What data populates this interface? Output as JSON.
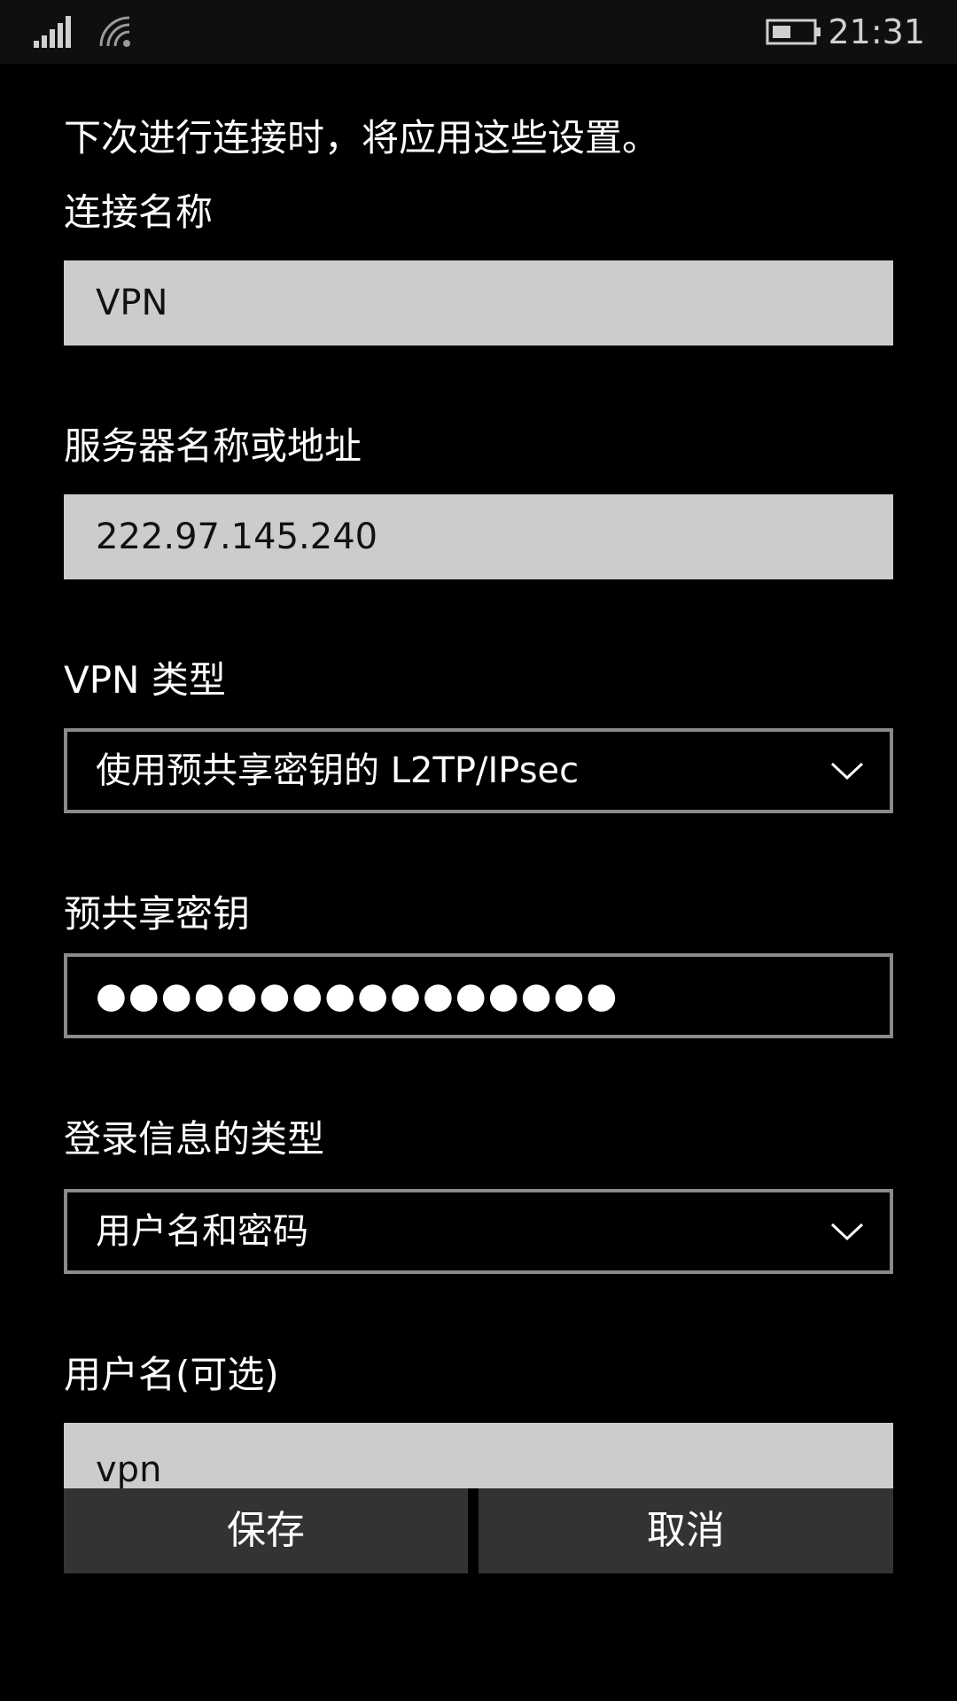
{
  "status_bar": {
    "time": "21:31",
    "icons": [
      "signal-icon",
      "wifi-icon",
      "battery-icon"
    ]
  },
  "form": {
    "intro": "下次进行连接时，将应用这些设置。",
    "connection_name": {
      "label": "连接名称",
      "value": "VPN"
    },
    "server": {
      "label": "服务器名称或地址",
      "value": "222.97.145.240"
    },
    "vpn_type": {
      "label": "VPN 类型",
      "value": "使用预共享密钥的 L2TP/IPsec"
    },
    "psk": {
      "label": "预共享密钥",
      "value": "●●●●●●●●●●●●●●●●"
    },
    "login_type": {
      "label": "登录信息的类型",
      "value": "用户名和密码"
    },
    "username": {
      "label": "用户名(可选)",
      "value": "vpn"
    }
  },
  "actions": {
    "save_label": "保存",
    "cancel_label": "取消"
  },
  "colors": {
    "background": "#000000",
    "filled_field": "#cccccc",
    "outline": "#8a8a8a",
    "button": "#333333"
  }
}
